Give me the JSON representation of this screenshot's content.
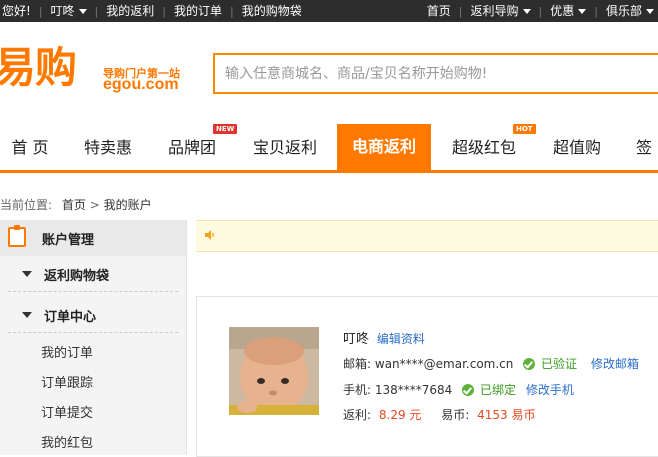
{
  "topbar": {
    "greeting": "您好!",
    "user": "叮咚",
    "left_links": [
      "我的返利",
      "我的订单",
      "我的购物袋"
    ],
    "right_links": [
      {
        "label": "首页",
        "dropdown": false
      },
      {
        "label": "返利导购",
        "dropdown": true
      },
      {
        "label": "优惠",
        "dropdown": true
      },
      {
        "label": "俱乐部",
        "dropdown": true
      }
    ]
  },
  "header": {
    "logo_text": "易购",
    "slogan": "导购门户第一站",
    "domain": "egou.com",
    "search_placeholder": "输入任意商城名、商品/宝贝名称开始购物!"
  },
  "nav": {
    "items": [
      {
        "label": "首 页",
        "badge": ""
      },
      {
        "label": "特卖惠",
        "badge": ""
      },
      {
        "label": "品牌团",
        "badge": "NEW"
      },
      {
        "label": "宝贝返利",
        "badge": ""
      },
      {
        "label": "电商返利",
        "badge": "",
        "active": true
      },
      {
        "label": "超级红包",
        "badge": "HOT"
      },
      {
        "label": "超值购",
        "badge": ""
      },
      {
        "label": "签",
        "badge": ""
      }
    ]
  },
  "breadcrumb": {
    "prefix": "当前位置:",
    "home": "首页",
    "separator": ">",
    "current": "我的账户"
  },
  "sidebar": {
    "title": "账户管理",
    "groups": [
      {
        "label": "返利购物袋",
        "links": []
      },
      {
        "label": "订单中心",
        "links": [
          "我的订单",
          "订单跟踪",
          "订单提交",
          "我的红包"
        ]
      }
    ]
  },
  "profile": {
    "name": "叮咚",
    "edit_label": "编辑资料",
    "email_label": "邮箱:",
    "email": "wan****@emar.com.cn",
    "email_status": "已验证",
    "email_action": "修改邮箱",
    "phone_label": "手机:",
    "phone": "138****7684",
    "phone_status": "已绑定",
    "phone_action": "修改手机",
    "rebate_label": "返利:",
    "rebate_value": "8.29 元",
    "coins_label": "易币:",
    "coins_value": "4153 易币"
  },
  "colors": {
    "brand_orange": "#ff7800",
    "topbar_bg": "#2d2d2d",
    "link_blue": "#2a6ec8",
    "success_green": "#5fb33d",
    "amount_red": "#e44a1f"
  }
}
